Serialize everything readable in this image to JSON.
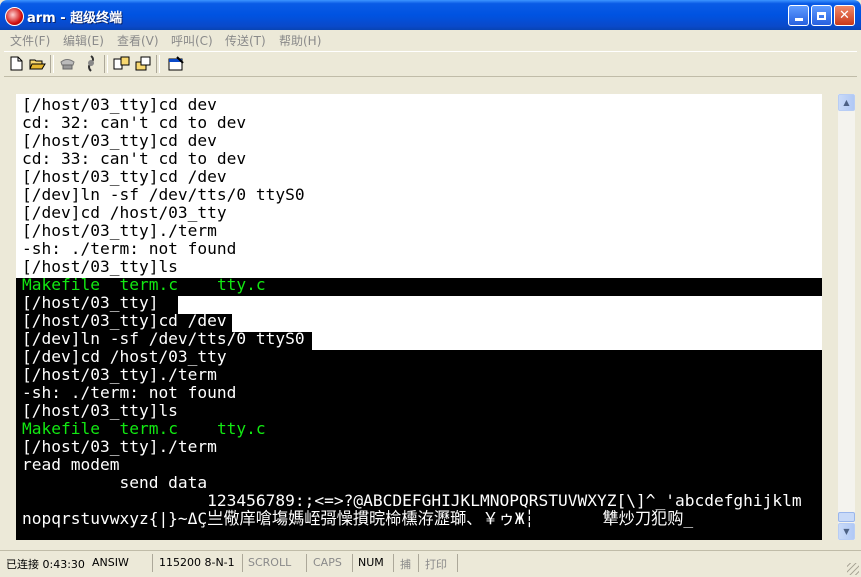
{
  "window": {
    "title": "arm - 超级终端"
  },
  "menu": [
    "文件(F)",
    "编辑(E)",
    "查看(V)",
    "呼叫(C)",
    "传送(T)",
    "帮助(H)"
  ],
  "toolbar": {
    "icons": [
      "new-icon",
      "open-icon",
      "connect-icon",
      "disconnect-icon",
      "send-icon",
      "receive-icon",
      "properties-icon"
    ]
  },
  "terminal": {
    "lines": [
      [
        {
          "t": "[/host/03_tty]cd dev"
        }
      ],
      [
        {
          "t": "cd: 32: can't cd to dev"
        }
      ],
      [
        {
          "t": "[/host/03_tty]cd dev"
        }
      ],
      [
        {
          "t": "cd: 33: can't cd to dev"
        }
      ],
      [
        {
          "t": "[/host/03_tty]cd /dev"
        }
      ],
      [
        {
          "t": "[/dev]ln -sf /dev/tts/0 ttyS0"
        }
      ],
      [
        {
          "t": "[/dev]cd /host/03_tty"
        }
      ],
      [
        {
          "t": "[/host/03_tty]./term"
        }
      ],
      [
        {
          "t": "-sh: ./term: not found"
        }
      ],
      [
        {
          "t": "[/host/03_tty]ls"
        }
      ],
      [
        {
          "t": "Makefile",
          "c": "green"
        },
        {
          "t": "  "
        },
        {
          "t": "term.c",
          "c": "green"
        },
        {
          "t": "    "
        },
        {
          "t": "tty.c",
          "c": "green"
        }
      ],
      [
        {
          "t": "[/host/03_tty]"
        }
      ],
      [
        {
          "t": "[/host/03_tty]cd /dev"
        }
      ],
      [
        {
          "t": "[/dev]ln -sf /dev/tts/0 ttyS0"
        }
      ],
      [
        {
          "t": "[/dev]cd /host/03_tty"
        }
      ],
      [
        {
          "t": "[/host/03_tty]./term"
        }
      ],
      [
        {
          "t": "-sh: ./term: not found"
        }
      ],
      [
        {
          "t": "[/host/03_tty]ls"
        }
      ],
      [
        {
          "t": "Makefile",
          "c": "green"
        },
        {
          "t": "  "
        },
        {
          "t": "term.c",
          "c": "green"
        },
        {
          "t": "    "
        },
        {
          "t": "tty.c",
          "c": "green"
        }
      ],
      [
        {
          "t": "[/host/03_tty]./term"
        }
      ],
      [
        {
          "t": "read modem"
        }
      ],
      [
        {
          "t": "          send data"
        }
      ],
      [
        {
          "t": "                   123456789:;<=>?@ABCDEFGHIJKLMNOPQRSTUVWXYZ[\\]^_'abcdefghijklm"
        }
      ],
      [
        {
          "t": "nopqrstuvwxyz{|}~ΔÇ亗儆庠嗆塲媽峌彁懆摜晥椧櫄洊瀝瑡、￥ゥЖ┆       犨炒刀犯购"
        }
      ]
    ],
    "cursor": "_"
  },
  "status": {
    "connected": "已连接 0:43:30",
    "emulation": "ANSIW",
    "port": "115200 8-N-1",
    "scroll": "SCROLL",
    "caps": "CAPS",
    "num": "NUM",
    "capture": "捕",
    "print": "打印"
  }
}
